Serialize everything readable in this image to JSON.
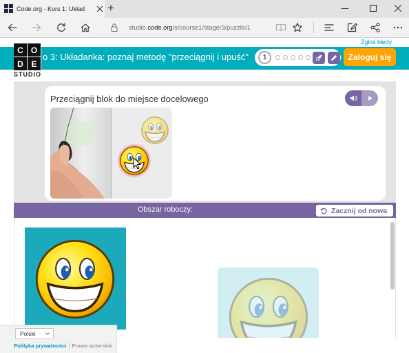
{
  "browser": {
    "tab_title": "Code.org - Kurs 1: Układ",
    "new_tab_label": "+",
    "url": {
      "prefix": "studio.",
      "domain": "code.org",
      "path": "/s/course1/stage/3/puzzle/1"
    },
    "icons": [
      "favicon-icon",
      "close-tab-icon",
      "minimize-icon",
      "maximize-icon",
      "close-window-icon",
      "back-arrow-icon",
      "forward-arrow-icon",
      "refresh-icon",
      "home-icon",
      "lock-icon",
      "reading-view-icon",
      "favorite-star-icon",
      "hub-icon",
      "web-note-icon",
      "share-icon",
      "more-icon"
    ]
  },
  "header": {
    "report_link": "Zgłoś błędy",
    "logo": {
      "letters": [
        "C",
        "O",
        "D",
        "E"
      ],
      "subtitle": "STUDIO"
    },
    "title": "o 3: Układanka: poznaj metodę \"przeciągnij i upuść\"",
    "progress": {
      "current_level": "1",
      "other_levels": 5
    },
    "login_button": "Zaloguj się"
  },
  "instructions": {
    "text": "Przeciągnij blok do miejsce docelowego",
    "icons": [
      "speaker-icon",
      "play-icon"
    ]
  },
  "workspace": {
    "label": "Obszar roboczy:",
    "reset_button": "Zacznij od nowa"
  },
  "footer": {
    "language": "Polski",
    "privacy": "Polityka prywatności",
    "separator": "|",
    "copyright": "Prawa autorskie"
  },
  "colors": {
    "header": "#00adbc",
    "purple": "#7665a0",
    "purple-light": "#a69bc1",
    "login": "#ffa400",
    "block": "#1ba9bb",
    "target": "#d3eef3",
    "link": "#0094ca"
  }
}
